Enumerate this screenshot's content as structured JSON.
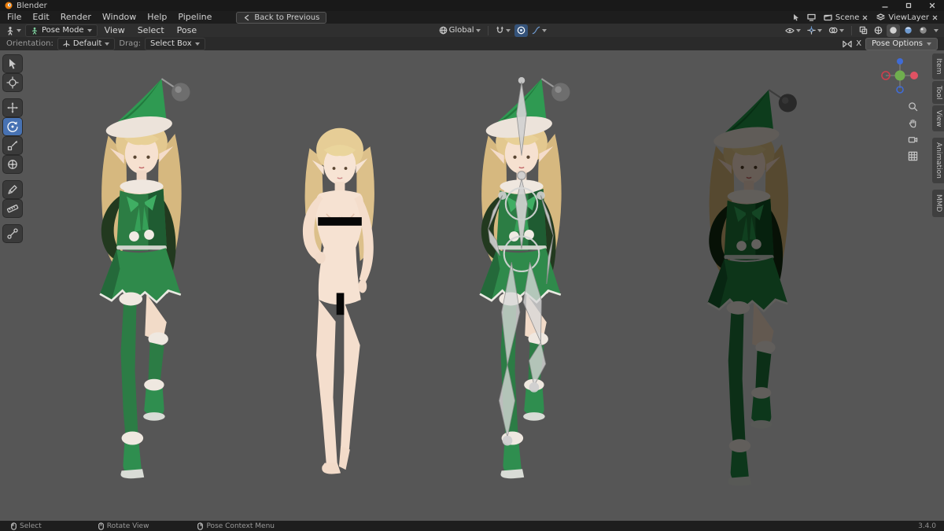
{
  "window": {
    "title": "Blender"
  },
  "menubar": {
    "items": [
      "File",
      "Edit",
      "Render",
      "Window",
      "Help",
      "Pipeline"
    ],
    "back_button": "Back to Previous",
    "scene": "Scene",
    "viewlayer": "ViewLayer"
  },
  "viewport_header": {
    "mode": "Pose Mode",
    "menus": [
      "View",
      "Select",
      "Pose"
    ],
    "orientation": "Global"
  },
  "tool_settings": {
    "orientation_label": "Orientation:",
    "orientation_value": "Default",
    "drag_label": "Drag:",
    "drag_value": "Select Box",
    "mirror_label": "X",
    "pose_options": "Pose Options"
  },
  "left_toolbar": {
    "active": "rotate",
    "tools": [
      "select-box",
      "cursor",
      "move",
      "rotate",
      "scale",
      "transform",
      "annotate",
      "measure",
      "pose-extra"
    ]
  },
  "sidebar_tabs": [
    "Item",
    "Tool",
    "View",
    "Animation",
    "MMD"
  ],
  "viewport_figures": [
    "clothed-elf-outfit",
    "base-body-censored",
    "outfit-with-armature",
    "dark-wireframe"
  ],
  "statusbar": {
    "select": "Select",
    "rotate_view": "Rotate View",
    "context_menu": "Pose Context Menu",
    "version": "3.4.0"
  },
  "colors": {
    "accent": "#4772b3",
    "viewport_bg": "#565656",
    "elf_green": "#2f8a4b",
    "skin": "#f4ddcb",
    "censor": "#070707"
  }
}
